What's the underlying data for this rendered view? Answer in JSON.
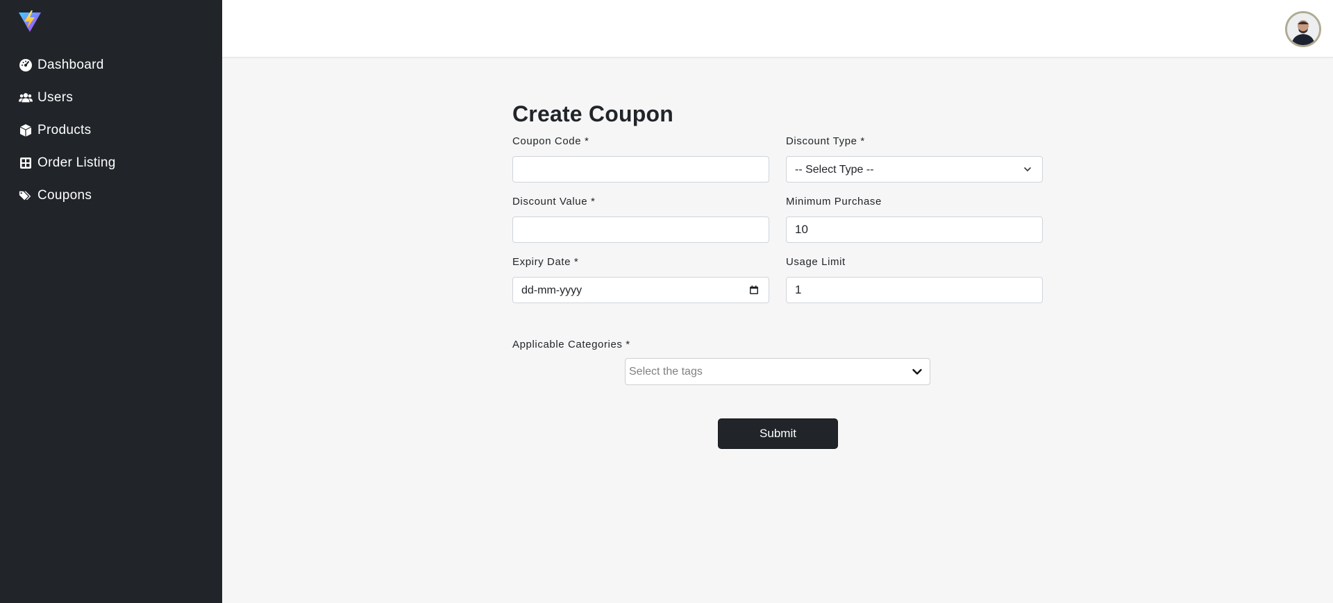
{
  "sidebar": {
    "logo_icon": "lightning-v-logo",
    "items": [
      {
        "label": "Dashboard",
        "icon": "gauge-icon"
      },
      {
        "label": "Users",
        "icon": "users-icon"
      },
      {
        "label": "Products",
        "icon": "box-icon"
      },
      {
        "label": "Order Listing",
        "icon": "grid-icon"
      },
      {
        "label": "Coupons",
        "icon": "tags-icon"
      }
    ]
  },
  "header": {
    "avatar_icon": "user-avatar"
  },
  "form": {
    "title": "Create Coupon",
    "coupon_code": {
      "label": "Coupon Code *",
      "value": ""
    },
    "discount_type": {
      "label": "Discount Type *",
      "value": "-- Select Type --"
    },
    "discount_value": {
      "label": "Discount Value *",
      "value": ""
    },
    "minimum_purchase": {
      "label": "Minimum Purchase",
      "value": "10"
    },
    "expiry_date": {
      "label": "Expiry Date *",
      "value": "dd-mm-yyyy"
    },
    "usage_limit": {
      "label": "Usage Limit",
      "value": "1"
    },
    "categories": {
      "label": "Applicable Categories *",
      "placeholder": "Select the tags"
    },
    "submit_label": "Submit"
  },
  "colors": {
    "sidebar_bg": "#212529",
    "page_bg": "#f6f6f6",
    "button_bg": "#212529"
  }
}
